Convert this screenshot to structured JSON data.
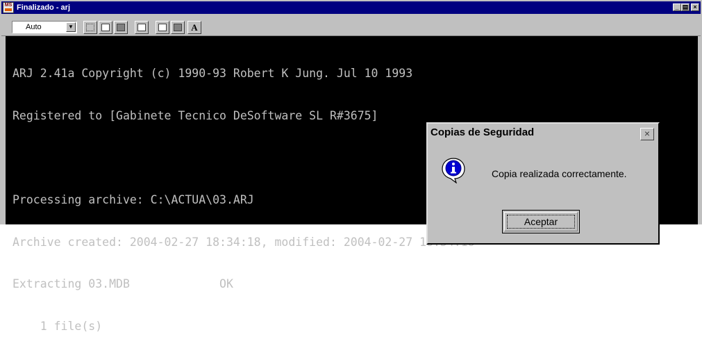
{
  "window": {
    "title": "Finalizado - arj",
    "icon_label": "MS"
  },
  "toolbar": {
    "font_size_value": "Auto",
    "font_button_label": "A"
  },
  "console": {
    "lines": [
      "ARJ 2.41a Copyright (c) 1990-93 Robert K Jung. Jul 10 1993",
      "Registered to [Gabinete Tecnico DeSoftware SL R#3675]",
      "",
      "Processing archive: C:\\ACTUA\\03.ARJ",
      "Archive created: 2004-02-27 18:34:18, modified: 2004-02-27 18:34:18",
      "Extracting 03.MDB             OK",
      "    1 file(s)"
    ]
  },
  "dialog": {
    "title": "Copias de Seguridad",
    "message": "Copia realizada correctamente.",
    "ok_label": "Aceptar",
    "icon": "info-icon"
  },
  "colors": {
    "title_bar": "#000080",
    "console_bg": "#000000",
    "console_text": "#c0c0c0",
    "chrome": "#c0c0c0"
  }
}
